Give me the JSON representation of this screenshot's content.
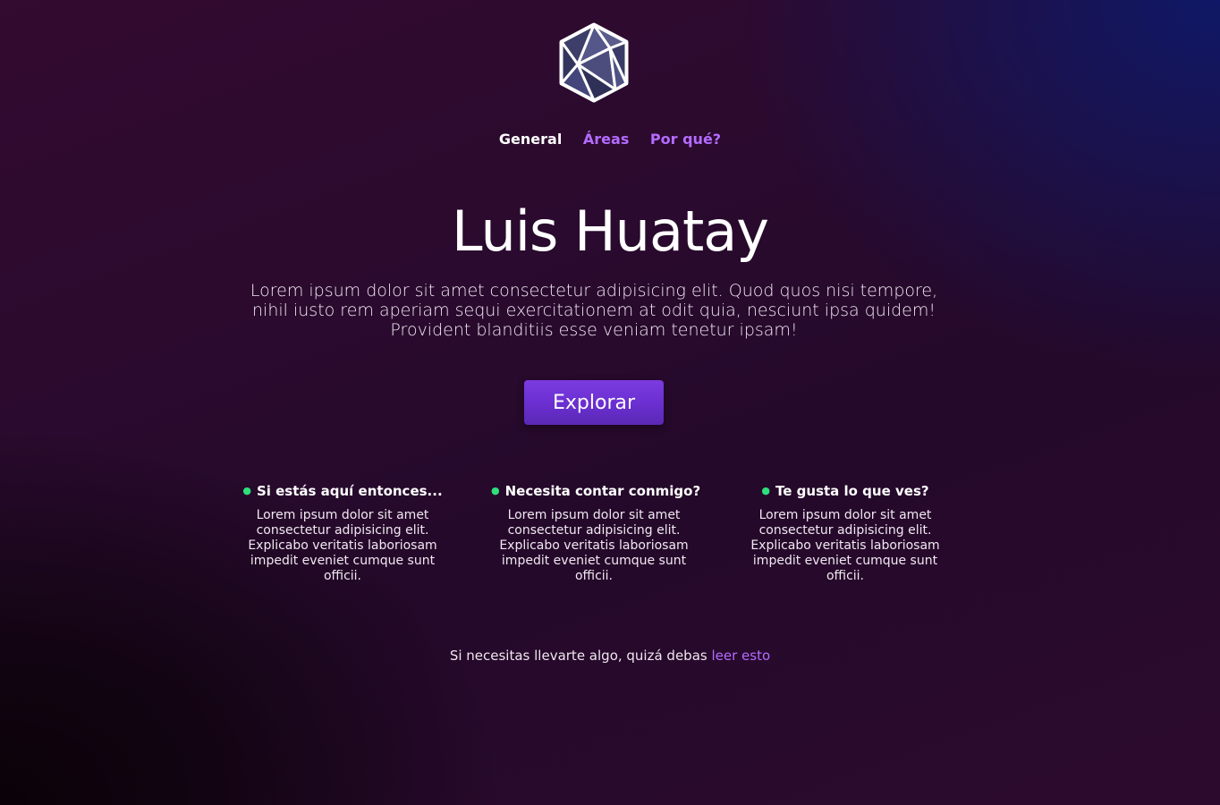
{
  "logo": {
    "icon": "hexagon-polyhedron-logo"
  },
  "nav": {
    "items": [
      {
        "label": "General",
        "active": true
      },
      {
        "label": "Áreas",
        "active": false
      },
      {
        "label": "Por qué?",
        "active": false
      }
    ]
  },
  "hero": {
    "title": "Luis Huatay",
    "text": "Lorem ipsum dolor sit amet consectetur adipisicing elit. Quod quos nisi tempore, nihil iusto rem aperiam sequi exercitationem at odit quia, nesciunt ipsa quidem! Provident blanditiis esse veniam tenetur ipsam!",
    "button_label": "Explorar"
  },
  "features": [
    {
      "title": "Si estás aquí entonces...",
      "text": "Lorem ipsum dolor sit amet consectetur adipisicing elit. Explicabo veritatis laboriosam impedit eveniet cumque sunt officii."
    },
    {
      "title": "Necesita contar conmigo?",
      "text": "Lorem ipsum dolor sit amet consectetur adipisicing elit. Explicabo veritatis laboriosam impedit eveniet cumque sunt officii."
    },
    {
      "title": "Te gusta lo que ves?",
      "text": "Lorem ipsum dolor sit amet consectetur adipisicing elit. Explicabo veritatis laboriosam impedit eveniet cumque sunt officii."
    }
  ],
  "footer": {
    "text": "Si necesitas llevarte algo, quizá debas",
    "link_label": "leer esto"
  },
  "colors": {
    "accent": "#b46cff",
    "button": "#6a2fd0",
    "bullet": "#2ee07a"
  }
}
